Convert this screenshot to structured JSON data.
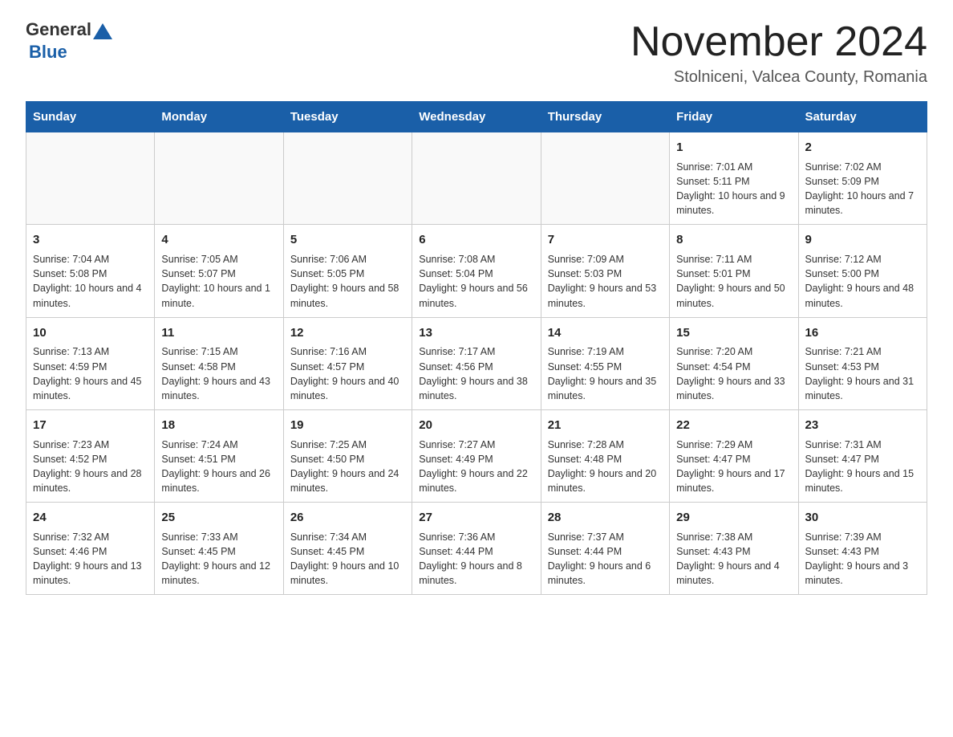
{
  "header": {
    "logo_general": "General",
    "logo_blue": "Blue",
    "title": "November 2024",
    "subtitle": "Stolniceni, Valcea County, Romania"
  },
  "days_of_week": [
    "Sunday",
    "Monday",
    "Tuesday",
    "Wednesday",
    "Thursday",
    "Friday",
    "Saturday"
  ],
  "weeks": [
    [
      {
        "day": "",
        "info": ""
      },
      {
        "day": "",
        "info": ""
      },
      {
        "day": "",
        "info": ""
      },
      {
        "day": "",
        "info": ""
      },
      {
        "day": "",
        "info": ""
      },
      {
        "day": "1",
        "info": "Sunrise: 7:01 AM\nSunset: 5:11 PM\nDaylight: 10 hours and 9 minutes."
      },
      {
        "day": "2",
        "info": "Sunrise: 7:02 AM\nSunset: 5:09 PM\nDaylight: 10 hours and 7 minutes."
      }
    ],
    [
      {
        "day": "3",
        "info": "Sunrise: 7:04 AM\nSunset: 5:08 PM\nDaylight: 10 hours and 4 minutes."
      },
      {
        "day": "4",
        "info": "Sunrise: 7:05 AM\nSunset: 5:07 PM\nDaylight: 10 hours and 1 minute."
      },
      {
        "day": "5",
        "info": "Sunrise: 7:06 AM\nSunset: 5:05 PM\nDaylight: 9 hours and 58 minutes."
      },
      {
        "day": "6",
        "info": "Sunrise: 7:08 AM\nSunset: 5:04 PM\nDaylight: 9 hours and 56 minutes."
      },
      {
        "day": "7",
        "info": "Sunrise: 7:09 AM\nSunset: 5:03 PM\nDaylight: 9 hours and 53 minutes."
      },
      {
        "day": "8",
        "info": "Sunrise: 7:11 AM\nSunset: 5:01 PM\nDaylight: 9 hours and 50 minutes."
      },
      {
        "day": "9",
        "info": "Sunrise: 7:12 AM\nSunset: 5:00 PM\nDaylight: 9 hours and 48 minutes."
      }
    ],
    [
      {
        "day": "10",
        "info": "Sunrise: 7:13 AM\nSunset: 4:59 PM\nDaylight: 9 hours and 45 minutes."
      },
      {
        "day": "11",
        "info": "Sunrise: 7:15 AM\nSunset: 4:58 PM\nDaylight: 9 hours and 43 minutes."
      },
      {
        "day": "12",
        "info": "Sunrise: 7:16 AM\nSunset: 4:57 PM\nDaylight: 9 hours and 40 minutes."
      },
      {
        "day": "13",
        "info": "Sunrise: 7:17 AM\nSunset: 4:56 PM\nDaylight: 9 hours and 38 minutes."
      },
      {
        "day": "14",
        "info": "Sunrise: 7:19 AM\nSunset: 4:55 PM\nDaylight: 9 hours and 35 minutes."
      },
      {
        "day": "15",
        "info": "Sunrise: 7:20 AM\nSunset: 4:54 PM\nDaylight: 9 hours and 33 minutes."
      },
      {
        "day": "16",
        "info": "Sunrise: 7:21 AM\nSunset: 4:53 PM\nDaylight: 9 hours and 31 minutes."
      }
    ],
    [
      {
        "day": "17",
        "info": "Sunrise: 7:23 AM\nSunset: 4:52 PM\nDaylight: 9 hours and 28 minutes."
      },
      {
        "day": "18",
        "info": "Sunrise: 7:24 AM\nSunset: 4:51 PM\nDaylight: 9 hours and 26 minutes."
      },
      {
        "day": "19",
        "info": "Sunrise: 7:25 AM\nSunset: 4:50 PM\nDaylight: 9 hours and 24 minutes."
      },
      {
        "day": "20",
        "info": "Sunrise: 7:27 AM\nSunset: 4:49 PM\nDaylight: 9 hours and 22 minutes."
      },
      {
        "day": "21",
        "info": "Sunrise: 7:28 AM\nSunset: 4:48 PM\nDaylight: 9 hours and 20 minutes."
      },
      {
        "day": "22",
        "info": "Sunrise: 7:29 AM\nSunset: 4:47 PM\nDaylight: 9 hours and 17 minutes."
      },
      {
        "day": "23",
        "info": "Sunrise: 7:31 AM\nSunset: 4:47 PM\nDaylight: 9 hours and 15 minutes."
      }
    ],
    [
      {
        "day": "24",
        "info": "Sunrise: 7:32 AM\nSunset: 4:46 PM\nDaylight: 9 hours and 13 minutes."
      },
      {
        "day": "25",
        "info": "Sunrise: 7:33 AM\nSunset: 4:45 PM\nDaylight: 9 hours and 12 minutes."
      },
      {
        "day": "26",
        "info": "Sunrise: 7:34 AM\nSunset: 4:45 PM\nDaylight: 9 hours and 10 minutes."
      },
      {
        "day": "27",
        "info": "Sunrise: 7:36 AM\nSunset: 4:44 PM\nDaylight: 9 hours and 8 minutes."
      },
      {
        "day": "28",
        "info": "Sunrise: 7:37 AM\nSunset: 4:44 PM\nDaylight: 9 hours and 6 minutes."
      },
      {
        "day": "29",
        "info": "Sunrise: 7:38 AM\nSunset: 4:43 PM\nDaylight: 9 hours and 4 minutes."
      },
      {
        "day": "30",
        "info": "Sunrise: 7:39 AM\nSunset: 4:43 PM\nDaylight: 9 hours and 3 minutes."
      }
    ]
  ]
}
